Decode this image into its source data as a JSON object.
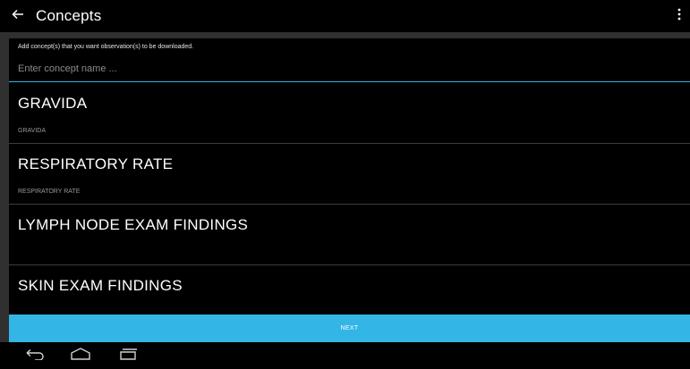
{
  "action_bar": {
    "title": "Concepts",
    "back_icon": "arrow-left-icon",
    "menu_icon": "overflow-menu-icon"
  },
  "hint": "Add concept(s) that you want observation(s) to be downloaded.",
  "search": {
    "placeholder": "Enter concept name ...",
    "value": ""
  },
  "concepts": [
    {
      "name": "GRAVIDA",
      "sub": "GRAVIDA"
    },
    {
      "name": "RESPIRATORY RATE",
      "sub": "RESPIRATORY RATE"
    },
    {
      "name": "LYMPH NODE EXAM FINDINGS",
      "sub": ""
    },
    {
      "name": "SKIN EXAM FINDINGS",
      "sub": ""
    }
  ],
  "next_label": "NEXT",
  "nav_bar": {
    "back_icon": "nav-back-icon",
    "home_icon": "nav-home-icon",
    "recents_icon": "nav-recents-icon"
  },
  "colors": {
    "accent": "#33b5e5",
    "background": "#000000",
    "frame": "#303030"
  }
}
